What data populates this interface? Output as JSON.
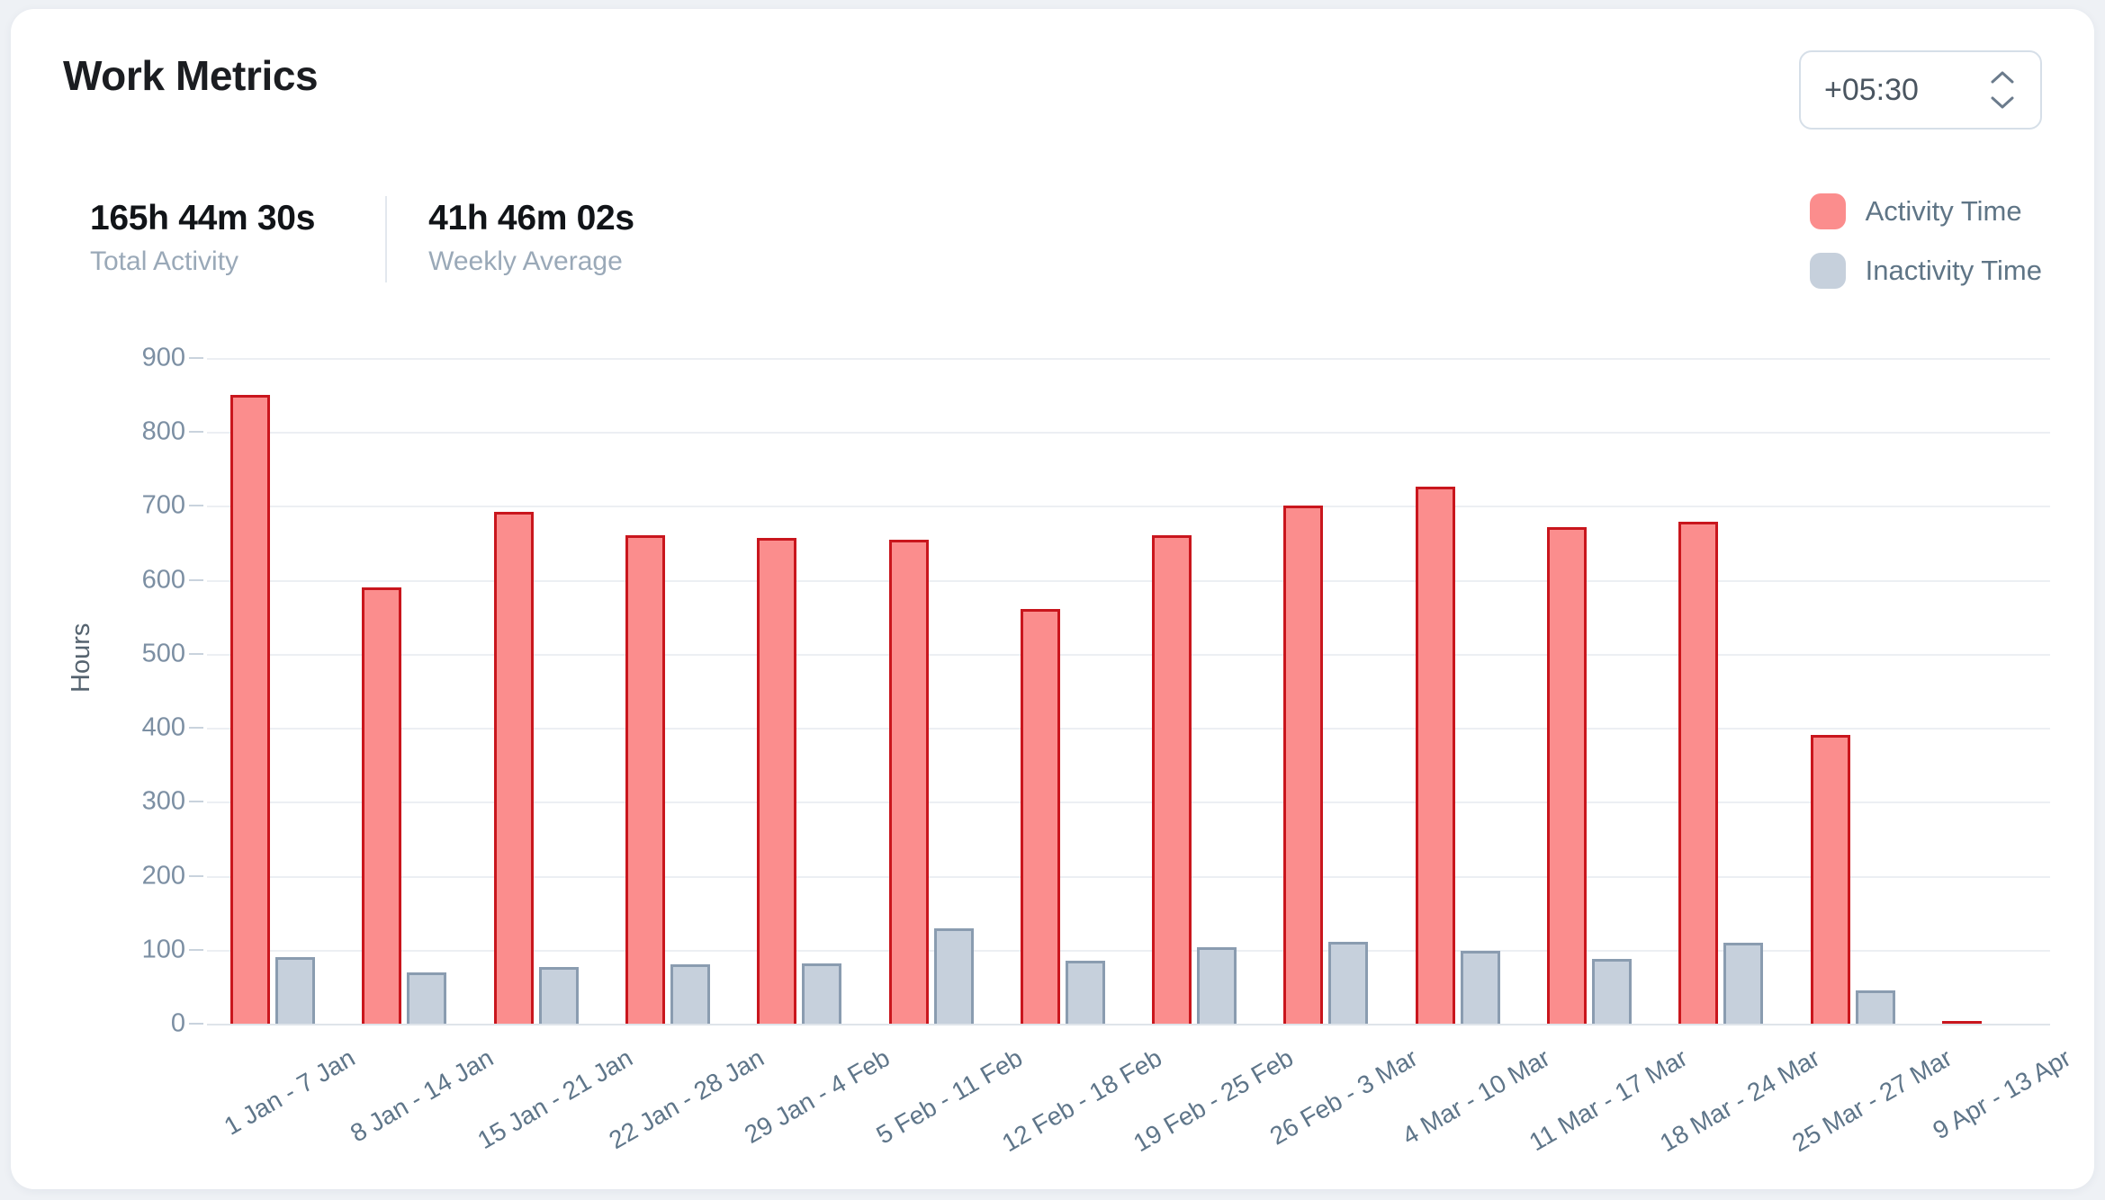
{
  "header": {
    "title": "Work Metrics",
    "timezone": {
      "value": "+05:30",
      "icon": "chevron-up-down-icon"
    }
  },
  "stats": [
    {
      "value": "165h 44m 30s",
      "label": "Total Activity"
    },
    {
      "value": "41h 46m 02s",
      "label": "Weekly Average"
    }
  ],
  "legend": [
    {
      "label": "Activity Time",
      "color": "#fb8d8d"
    },
    {
      "label": "Inactivity Time",
      "color": "#c6d0dc"
    }
  ],
  "colors": {
    "activity_fill": "#fb8d8d",
    "activity_border": "#c9161d",
    "inactivity_fill": "#c6d0dc",
    "inactivity_border": "#8a9cb0",
    "page_background": "#eef1f5",
    "card_background": "#ffffff",
    "axis_text": "#7c8fa3",
    "muted_text": "#9aa9b8",
    "legend_text": "#5f7586"
  },
  "chart_data": {
    "type": "bar",
    "title": "Work Metrics",
    "xlabel": "",
    "ylabel": "Hours",
    "ylim": [
      0,
      900
    ],
    "yticks": [
      0,
      100,
      200,
      300,
      400,
      500,
      600,
      700,
      800,
      900
    ],
    "grid": true,
    "legend_position": "top-right",
    "categories": [
      "1 Jan - 7 Jan",
      "8 Jan - 14 Jan",
      "15 Jan - 21 Jan",
      "22 Jan - 28 Jan",
      "29 Jan - 4 Feb",
      "5 Feb - 11 Feb",
      "12 Feb - 18 Feb",
      "19 Feb - 25 Feb",
      "26 Feb - 3 Mar",
      "4 Mar - 10 Mar",
      "11 Mar - 17 Mar",
      "18 Mar - 24 Mar",
      "25 Mar - 27 Mar",
      "9 Apr - 13 Apr"
    ],
    "series": [
      {
        "name": "Activity Time",
        "color": "#fb8d8d",
        "values": [
          850,
          590,
          692,
          660,
          657,
          654,
          561,
          660,
          700,
          726,
          671,
          679,
          391,
          3
        ]
      },
      {
        "name": "Inactivity Time",
        "color": "#c6d0dc",
        "values": [
          90,
          69,
          77,
          80,
          81,
          129,
          85,
          103,
          111,
          99,
          87,
          110,
          45,
          0
        ]
      }
    ]
  }
}
